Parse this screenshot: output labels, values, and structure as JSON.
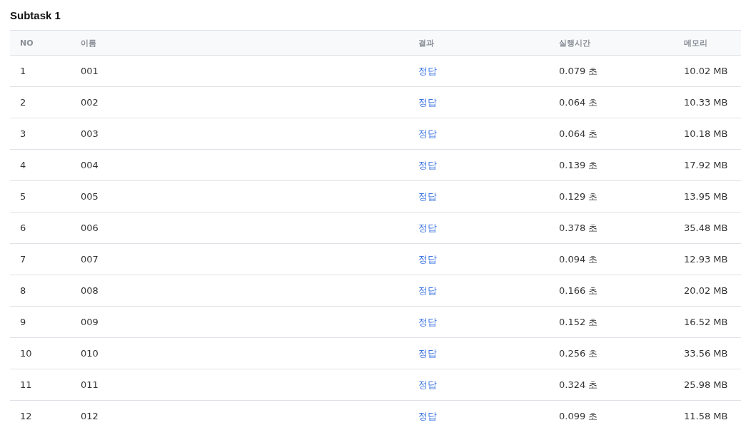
{
  "title": "Subtask 1",
  "table": {
    "columns": [
      "NO",
      "이름",
      "결과",
      "실행시간",
      "메모리"
    ],
    "rows": [
      [
        "1",
        "001",
        "정답",
        "0.079 초",
        "10.02 MB"
      ],
      [
        "2",
        "002",
        "정답",
        "0.064 초",
        "10.33 MB"
      ],
      [
        "3",
        "003",
        "정답",
        "0.064 초",
        "10.18 MB"
      ],
      [
        "4",
        "004",
        "정답",
        "0.139 초",
        "17.92 MB"
      ],
      [
        "5",
        "005",
        "정답",
        "0.129 초",
        "13.95 MB"
      ],
      [
        "6",
        "006",
        "정답",
        "0.378 초",
        "35.48 MB"
      ],
      [
        "7",
        "007",
        "정답",
        "0.094 초",
        "12.93 MB"
      ],
      [
        "8",
        "008",
        "정답",
        "0.166 초",
        "20.02 MB"
      ],
      [
        "9",
        "009",
        "정답",
        "0.152 초",
        "16.52 MB"
      ],
      [
        "10",
        "010",
        "정답",
        "0.256 초",
        "33.56 MB"
      ],
      [
        "11",
        "011",
        "정답",
        "0.324 초",
        "25.98 MB"
      ],
      [
        "12",
        "012",
        "정답",
        "0.099 초",
        "11.58 MB"
      ]
    ]
  }
}
